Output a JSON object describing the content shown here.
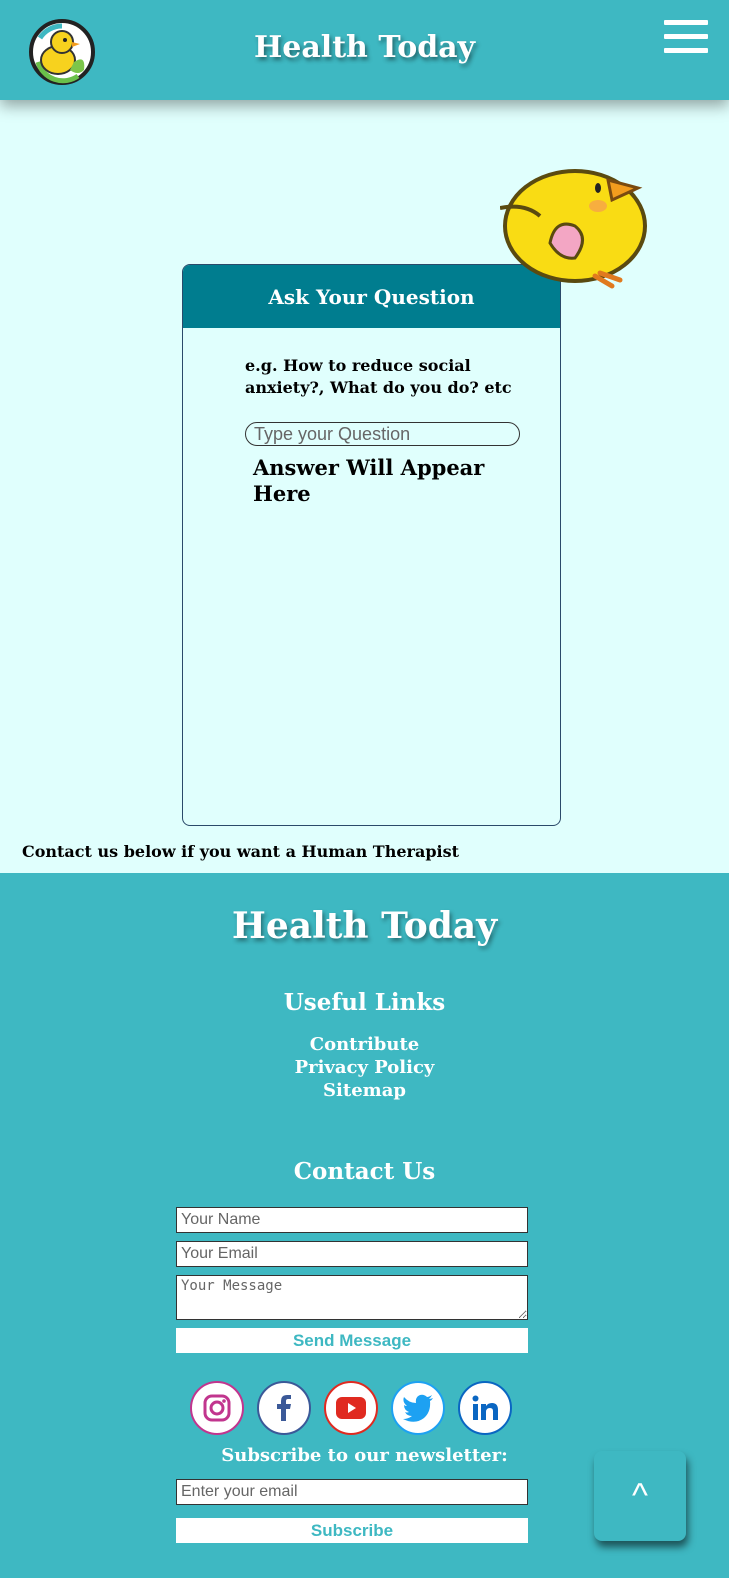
{
  "header": {
    "title": "Health Today",
    "logo_icon": "duck-logo-icon",
    "menu_icon": "hamburger-menu-icon"
  },
  "ask": {
    "heading": "Ask Your Question",
    "hint": "e.g. How to reduce social anxiety?, What do you do? etc",
    "input_placeholder": "Type your Question",
    "answer_placeholder": "Answer Will Appear Here",
    "mascot_icon": "duck-mascot-icon"
  },
  "contact_note": "Contact us below if you want a Human Therapist",
  "footer": {
    "title": "Health Today",
    "useful_links_title": "Useful Links",
    "links": [
      "Contribute",
      "Privacy Policy",
      "Sitemap"
    ],
    "contact_title": "Contact Us",
    "name_placeholder": "Your Name",
    "email_placeholder": "Your Email",
    "message_placeholder": "Your Message",
    "send_label": "Send Message",
    "socials": [
      "instagram-icon",
      "facebook-icon",
      "youtube-icon",
      "twitter-icon",
      "linkedin-icon"
    ],
    "newsletter_label": "Subscribe to our newsletter:",
    "newsletter_placeholder": "Enter your email",
    "subscribe_label": "Subscribe"
  },
  "scroll_top_label": "^",
  "colors": {
    "teal": "#3eb8c2",
    "dark_teal": "#007d8f",
    "background": "#e0fffd"
  }
}
